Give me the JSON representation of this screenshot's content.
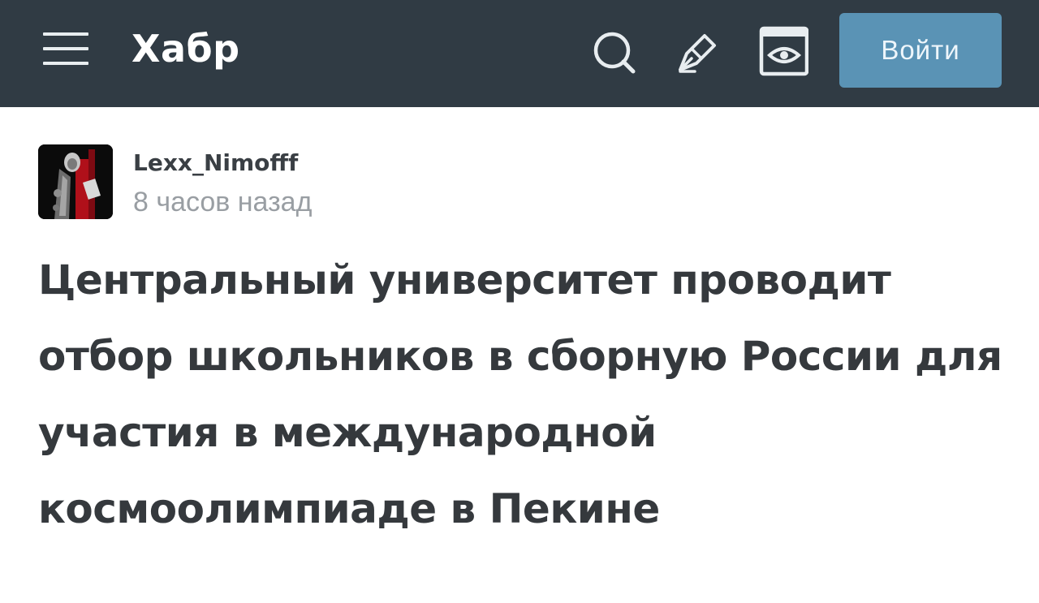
{
  "header": {
    "logo": "Хабр",
    "menu_icon": "hamburger-menu-icon",
    "search_icon": "search-icon",
    "write_icon": "pen-nib-icon",
    "view_icon": "eye-icon",
    "login_label": "Войти",
    "colors": {
      "bar": "#303b44",
      "login": "#5a93b5"
    }
  },
  "post": {
    "author": "Lexx_Nimofff",
    "published": "8 часов назад",
    "title": "Центральный университет проводит отбор школьников в сборную России для участия в международной космоолимпиаде в Пекине"
  }
}
